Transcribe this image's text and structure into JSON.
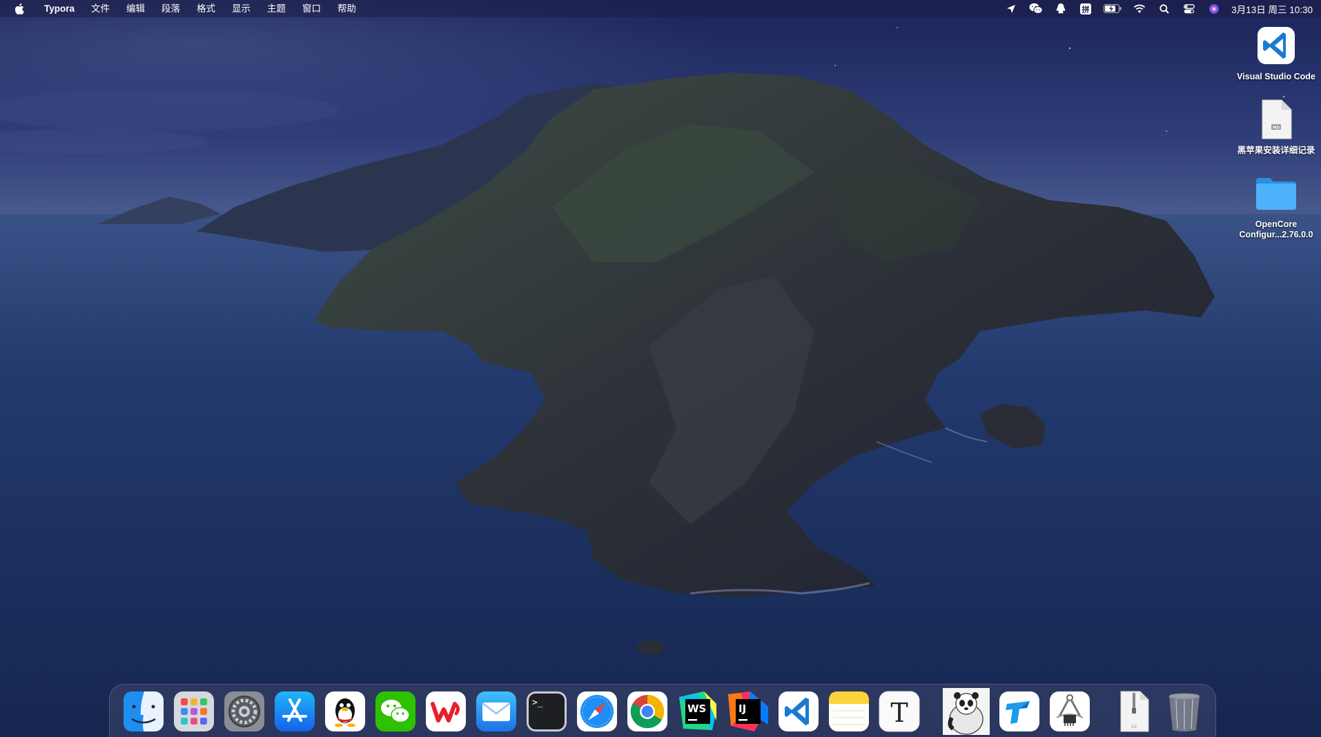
{
  "menubar": {
    "app_name": "Typora",
    "menus": [
      "文件",
      "编辑",
      "段落",
      "格式",
      "显示",
      "主题",
      "窗口",
      "帮助"
    ],
    "status_icons": [
      "location-arrow-icon",
      "wechat-icon",
      "qq-icon",
      "input-method-icon",
      "battery-icon",
      "wifi-icon",
      "spotlight-search-icon",
      "control-center-icon",
      "siri-icon"
    ],
    "input_method_label": "拼",
    "clock": "3月13日 周三 10:30"
  },
  "desktop": {
    "items": [
      {
        "label": "Visual Studio Code",
        "icon": "vscode-icon"
      },
      {
        "label": "黑苹果安装详细记录",
        "icon": "markdown-file-icon",
        "file_badge": "MD"
      },
      {
        "label_line1": "OpenCore",
        "label_line2": "Configur...2.76.0.0",
        "icon": "folder-icon"
      }
    ]
  },
  "dock": {
    "apps": [
      "finder",
      "launchpad",
      "system-preferences",
      "app-store",
      "qq",
      "wechat",
      "wps-office",
      "mail",
      "terminal",
      "safari",
      "chrome",
      "webstorm",
      "intellij-idea",
      "vscode",
      "notes",
      "typora"
    ],
    "extras": [
      "panda-app",
      "teambition-app",
      "system-info-app"
    ],
    "trash_items": [
      "zip-archive",
      "trash"
    ],
    "terminal_prompt": ">_",
    "webstorm_label": "WS",
    "intellij_label": "IJ",
    "typora_label": "T",
    "zip_label": "GZ"
  },
  "colors": {
    "menubar_bg": "#1e1e46",
    "sky_top": "#1c2659",
    "sea": "#1c2c58",
    "folder_blue": "#3aa0f5",
    "vscode_blue": "#1a7bd0"
  }
}
